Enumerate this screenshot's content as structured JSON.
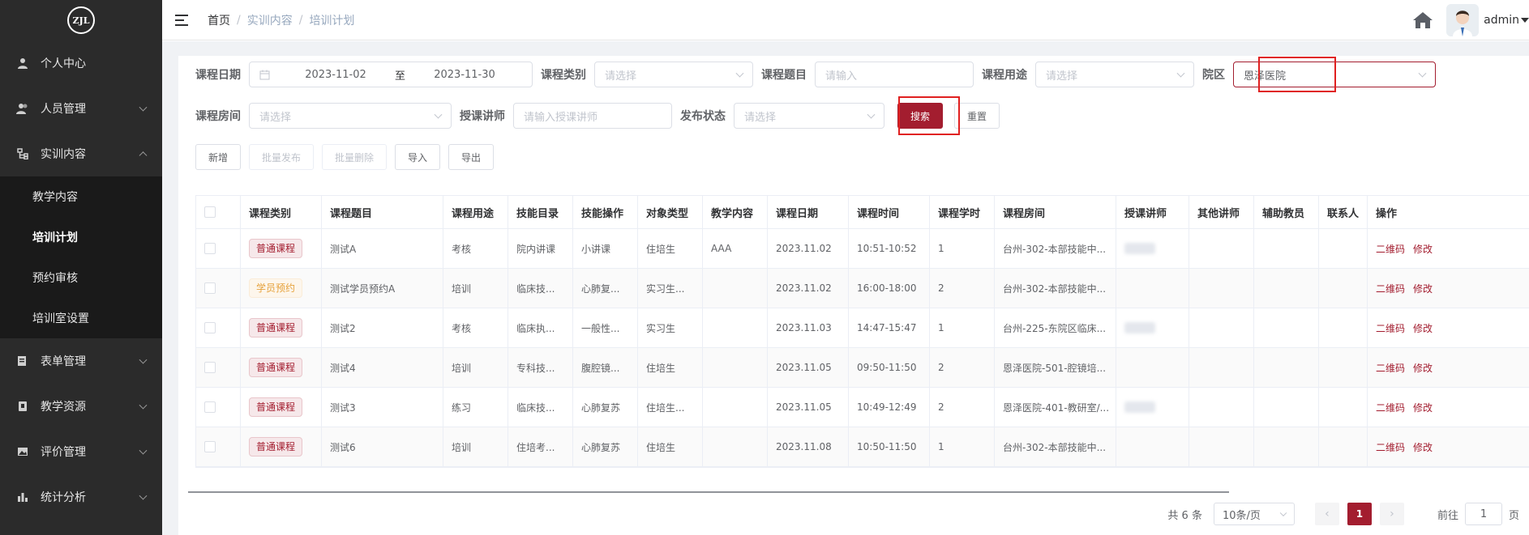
{
  "logo": {
    "text": "ZJL"
  },
  "sidebar": {
    "items": [
      {
        "label": "个人中心",
        "icon": "user-icon"
      },
      {
        "label": "人员管理",
        "icon": "users-icon"
      },
      {
        "label": "实训内容",
        "icon": "tree-icon"
      },
      {
        "label": "表单管理",
        "icon": "form-icon"
      },
      {
        "label": "教学资源",
        "icon": "book-icon"
      },
      {
        "label": "评价管理",
        "icon": "image-icon"
      },
      {
        "label": "统计分析",
        "icon": "chart-icon"
      }
    ],
    "submenu": [
      "教学内容",
      "培训计划",
      "预约审核",
      "培训室设置"
    ]
  },
  "breadcrumb": [
    "首页",
    "实训内容",
    "培训计划"
  ],
  "header": {
    "user": "admin"
  },
  "filters": {
    "course_date_label": "课程日期",
    "date_start": "2023-11-02",
    "date_sep": "至",
    "date_end": "2023-11-30",
    "course_type_label": "课程类别",
    "course_type_placeholder": "请选择",
    "course_title_label": "课程题目",
    "course_title_placeholder": "请输入",
    "course_use_label": "课程用途",
    "course_use_placeholder": "请选择",
    "campus_label": "院区",
    "campus_value": "恩泽医院",
    "room_label": "课程房间",
    "room_placeholder": "请选择",
    "teacher_label": "授课讲师",
    "teacher_placeholder": "请输入授课讲师",
    "status_label": "发布状态",
    "status_placeholder": "请选择",
    "search_btn": "搜索",
    "reset_btn": "重置"
  },
  "toolbar": {
    "add": "新增",
    "batch_publish": "批量发布",
    "batch_delete": "批量删除",
    "import": "导入",
    "export": "导出"
  },
  "table": {
    "headers": [
      "课程类别",
      "课程题目",
      "课程用途",
      "技能目录",
      "技能操作",
      "对象类型",
      "教学内容",
      "课程日期",
      "课程时间",
      "课程学时",
      "课程房间",
      "授课讲师",
      "其他讲师",
      "辅助教员",
      "联系人",
      "操作"
    ],
    "rows": [
      {
        "type": "普通课程",
        "type_color": "red",
        "title": "测试A",
        "use": "考核",
        "catalog": "院内讲课",
        "op": "小讲课",
        "obj": "住培生",
        "content": "AAA",
        "date": "2023.11.02",
        "time": "10:51-10:52",
        "hours": "1",
        "room": "台州-302-本部技能中...",
        "teacher_blur": true
      },
      {
        "type": "学员预约",
        "type_color": "orange",
        "title": "测试学员预约A",
        "use": "培训",
        "catalog": "临床技...",
        "op": "心肺复...",
        "obj": "实习生...",
        "content": "",
        "date": "2023.11.02",
        "time": "16:00-18:00",
        "hours": "2",
        "room": "台州-302-本部技能中...",
        "teacher_blur": false
      },
      {
        "type": "普通课程",
        "type_color": "red",
        "title": "测试2",
        "use": "考核",
        "catalog": "临床执...",
        "op": "一般性...",
        "obj": "实习生",
        "content": "",
        "date": "2023.11.03",
        "time": "14:47-15:47",
        "hours": "1",
        "room": "台州-225-东院区临床...",
        "teacher_blur": true
      },
      {
        "type": "普通课程",
        "type_color": "red",
        "title": "测试4",
        "use": "培训",
        "catalog": "专科技...",
        "op": "腹腔镜...",
        "obj": "住培生",
        "content": "",
        "date": "2023.11.05",
        "time": "09:50-11:50",
        "hours": "2",
        "room": "恩泽医院-501-腔镜培...",
        "teacher_blur": false
      },
      {
        "type": "普通课程",
        "type_color": "red",
        "title": "测试3",
        "use": "练习",
        "catalog": "临床技...",
        "op": "心肺复苏",
        "obj": "住培生...",
        "content": "",
        "date": "2023.11.05",
        "time": "10:49-12:49",
        "hours": "2",
        "room": "恩泽医院-401-教研室/...",
        "teacher_blur": true
      },
      {
        "type": "普通课程",
        "type_color": "red",
        "title": "测试6",
        "use": "培训",
        "catalog": "住培考...",
        "op": "心肺复苏",
        "obj": "住培生",
        "content": "",
        "date": "2023.11.08",
        "time": "10:50-11:50",
        "hours": "1",
        "room": "台州-302-本部技能中...",
        "teacher_blur": false
      }
    ],
    "actions": {
      "qr": "二维码",
      "edit": "修改"
    }
  },
  "pagination": {
    "total": "共 6 条",
    "page_size": "10条/页",
    "current": "1",
    "goto": "前往",
    "goto_value": "1",
    "page_unit": "页"
  },
  "colors": {
    "accent": "#a31d2f",
    "sidebar": "#2b2b2b"
  }
}
